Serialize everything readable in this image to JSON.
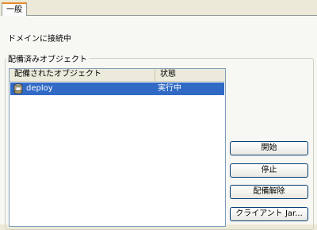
{
  "tabs": [
    {
      "label": "一般",
      "selected": true
    }
  ],
  "status_text": "ドメインに接続中",
  "group_title": "配備済みオブジェクト",
  "table": {
    "columns": [
      "配備されたオブジェクト",
      "状態"
    ],
    "rows": [
      {
        "icon": "deploy-object-icon",
        "name": "deploy",
        "state": "実行中",
        "selected": true
      }
    ]
  },
  "buttons": {
    "start": "開始",
    "stop": "停止",
    "undeploy": "配備解除",
    "client_jar": "クライアント Jar..."
  },
  "colors": {
    "selection": "#316ac5",
    "tab_accent": "#e68b2c",
    "panel_bg": "#f7f7f3"
  }
}
